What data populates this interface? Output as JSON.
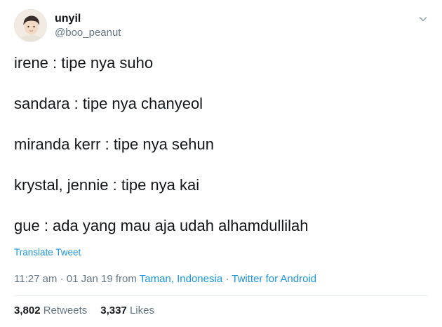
{
  "user": {
    "display_name": "unyil",
    "handle": "@boo_peanut",
    "avatar_icon": "profile-photo"
  },
  "menu_icon": "chevron-down-icon",
  "tweet": {
    "lines": [
      "irene : tipe nya suho",
      "sandara : tipe nya chanyeol",
      "miranda kerr : tipe nya sehun",
      "krystal, jennie : tipe nya kai",
      "gue : ada yang mau aja udah alhamdullilah"
    ],
    "translate_label": "Translate Tweet"
  },
  "meta": {
    "time": "11:27 am",
    "separator": " · ",
    "date": "01 Jan 19",
    "from_text": " from ",
    "location": "Taman, Indonesia",
    "client": "Twitter for Android"
  },
  "stats": {
    "retweets_count": "3,802",
    "retweets_label": "Retweets",
    "likes_count": "3,337",
    "likes_label": "Likes"
  },
  "colors": {
    "link": "#1b95e0",
    "secondary_text": "#657786",
    "primary_text": "#14171a",
    "divider": "#e6ecf0"
  }
}
